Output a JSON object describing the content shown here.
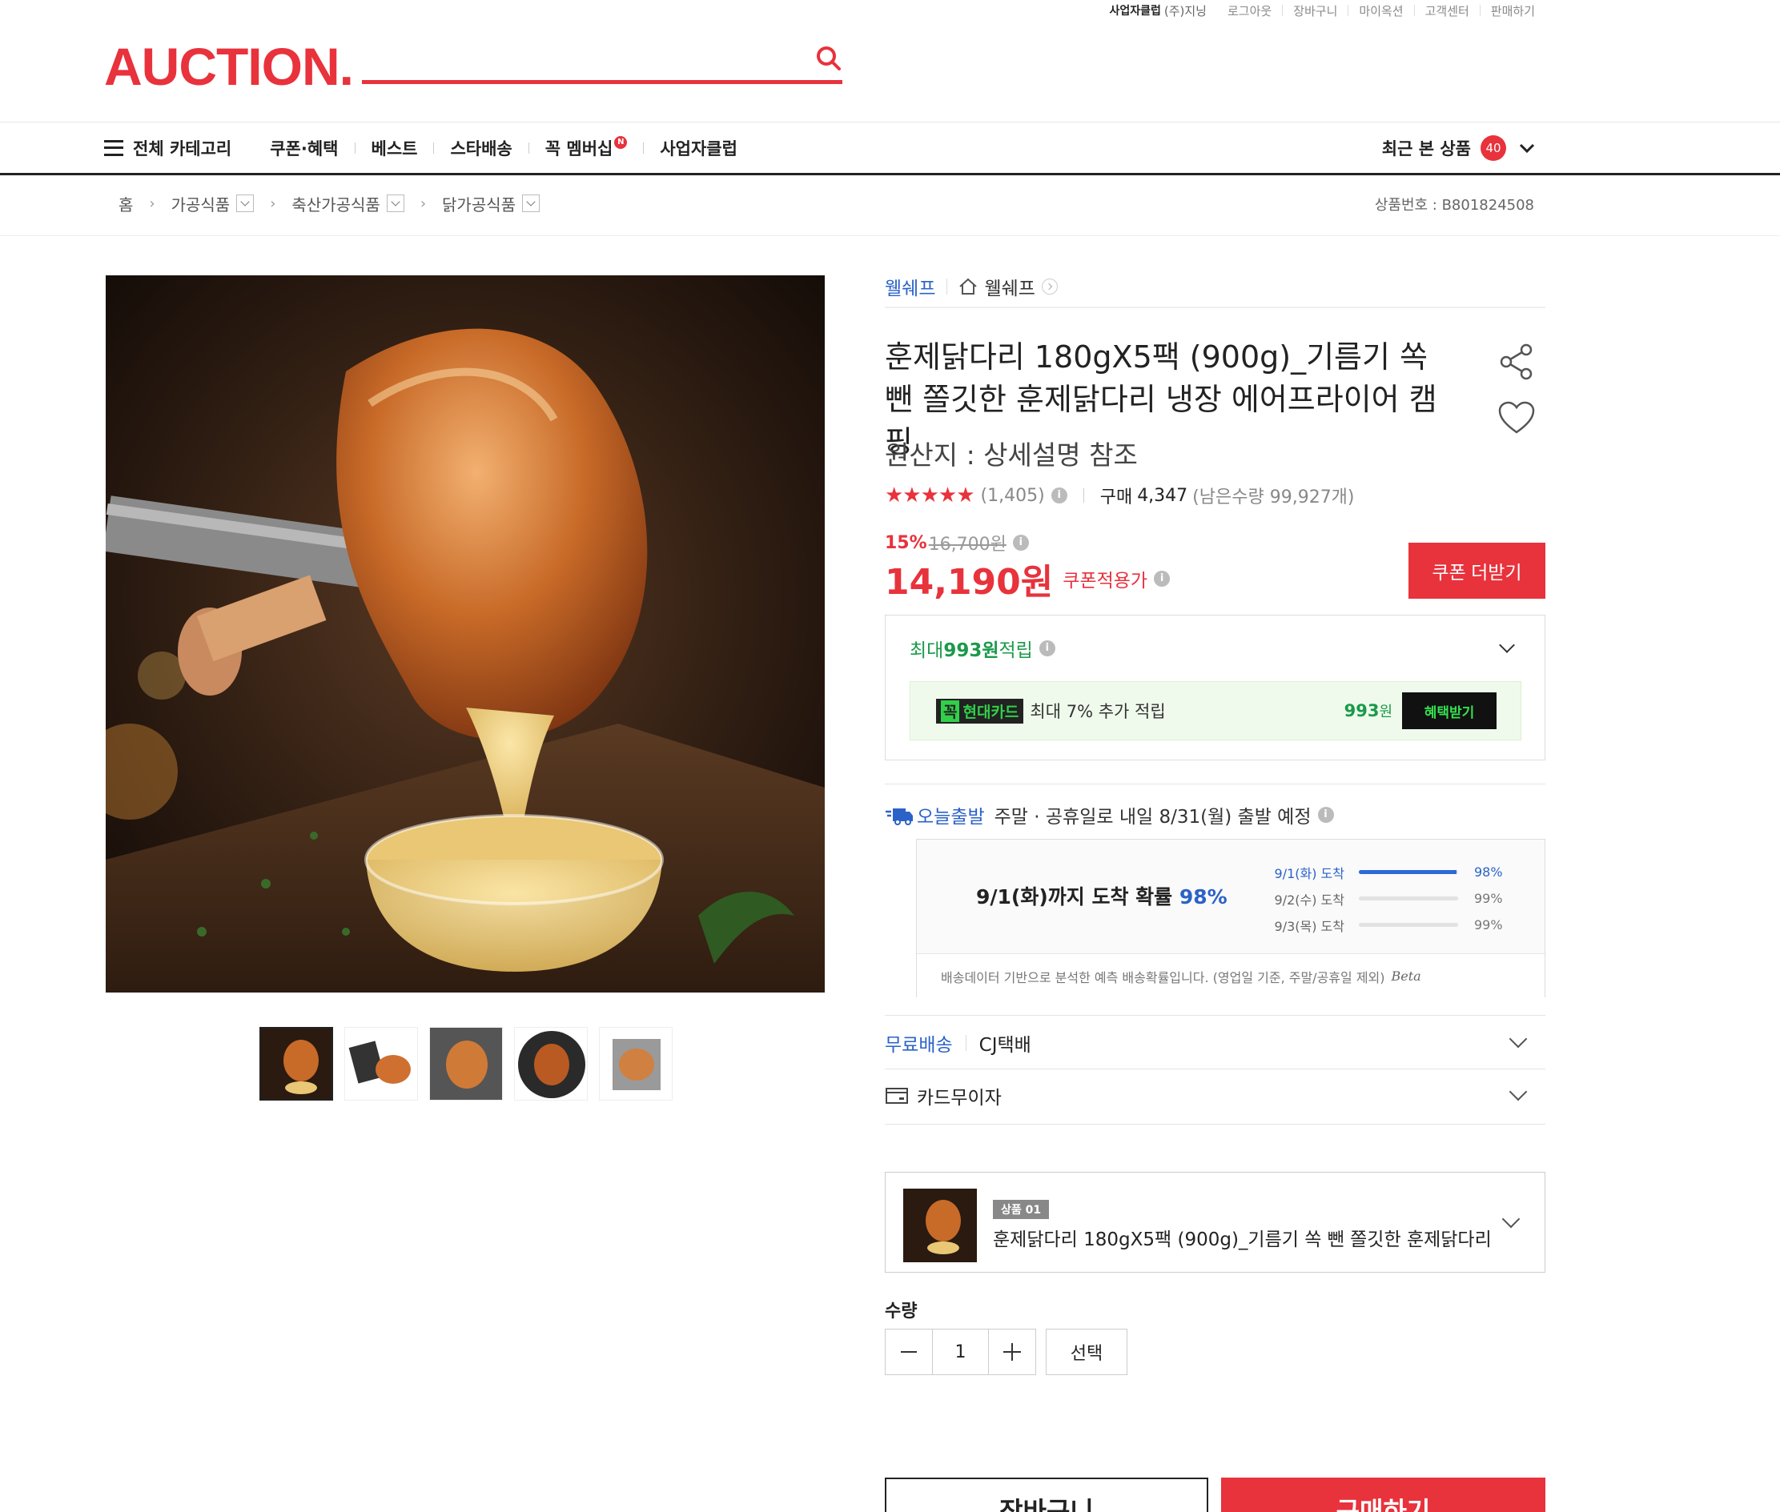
{
  "util": {
    "biz_club": "사업자클럽",
    "user": "(주)지닝",
    "links": [
      "로그아웃",
      "장바구니",
      "마이옥션",
      "고객센터",
      "판매하기"
    ]
  },
  "logo": "AUCTION.",
  "gnb": {
    "all_categories": "전체 카테고리",
    "items": [
      "쿠폰·혜택",
      "베스트",
      "스타배송",
      "꼭 멤버십",
      "사업자클럽"
    ],
    "membership_badge": "N",
    "recent_label": "최근 본 상품",
    "recent_count": "40"
  },
  "breadcrumb": {
    "home": "홈",
    "levels": [
      "가공식품",
      "축산가공식품",
      "닭가공식품"
    ],
    "product_no_label": "상품번호 : ",
    "product_no": "B801824508"
  },
  "product": {
    "brand": "웰쉐프",
    "store": "웰쉐프",
    "title": "훈제닭다리 180gX5팩 (900g)_기름기 쏙 뺀 쫄깃한 훈제닭다리 냉장 에어프라이어 캠핑",
    "origin": "원산지 : 상세설명 참조",
    "stars": "★★★★★",
    "review_count": "(1,405)",
    "purchase_label": "구매",
    "purchase_count": "4,347",
    "remaining": "(남은수량 99,927개)",
    "discount_pct": "15%",
    "original_price": "16,700원",
    "price": "14,190원",
    "price_label": "쿠폰적용가",
    "coupon_button": "쿠폰 더받기"
  },
  "reward": {
    "prefix": "최대 ",
    "amount": "993원",
    "suffix": " 적립",
    "card_k": "꼭",
    "card_name": "현대카드",
    "card_text": "최대 7% 추가 적립",
    "card_amount": "993",
    "card_unit": "원",
    "benefit_button": "혜택받기"
  },
  "shipping": {
    "today_label": "오늘출발",
    "notice": "주말 · 공휴일로 내일 8/31(월) 출발 예정",
    "prob_prefix": "9/1(화)까지 도착 확률 ",
    "prob_value": "98%",
    "rows": [
      {
        "date": "9/1(화) 도착",
        "pct": "98%",
        "fill": 0.98
      },
      {
        "date": "9/2(수) 도착",
        "pct": "99%",
        "fill": 0.0
      },
      {
        "date": "9/3(목) 도착",
        "pct": "99%",
        "fill": 0.0
      }
    ],
    "footnote": "배송데이터 기반으로 분석한 예측 배송확률입니다. (영업일 기준, 주말/공휴일 제외)",
    "beta": "Beta",
    "free_label": "무료배송",
    "courier": "CJ택배",
    "card_installment": "카드무이자"
  },
  "option": {
    "badge": "상품 01",
    "name": "훈제닭다리 180gX5팩 (900g)_기름기 쏙 뺀 쫄깃한 훈제닭다리 ..."
  },
  "quantity": {
    "label": "수량",
    "value": "1",
    "select_button": "선택"
  },
  "actions": {
    "cart": "장바구니",
    "buy": "구매하기"
  },
  "colors": {
    "brand_red": "#e8323c",
    "link_blue": "#2b62c8",
    "reward_green": "#1a9a4a"
  }
}
